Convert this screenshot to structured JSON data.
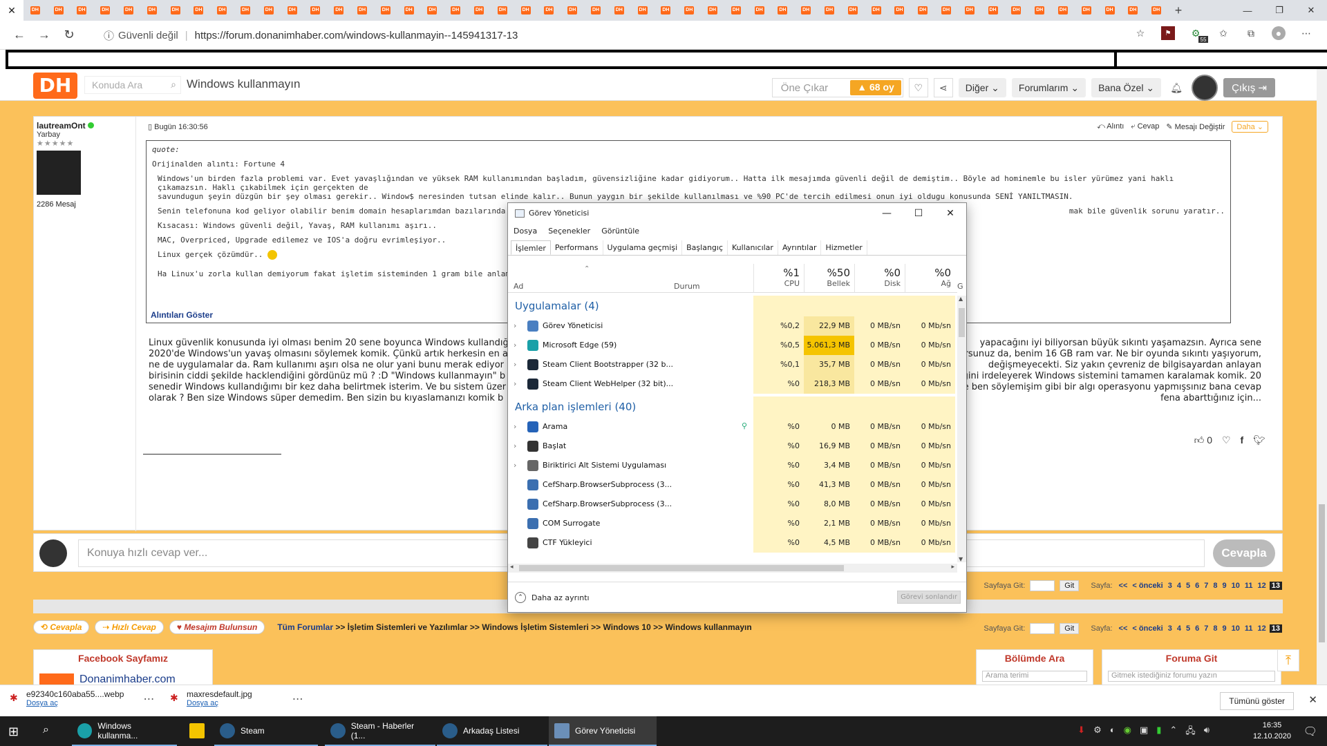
{
  "browser": {
    "tab_count": 49,
    "tab_favicon_label": "DH",
    "new_tab_icon": "+",
    "security_label": "Güvenli değil",
    "url": "https://forum.donanimhaber.com/windows-kullanmayin--145941317-13",
    "steam_ext_badge": "55"
  },
  "site": {
    "logo": "DH",
    "search_placeholder": "Konuda Ara",
    "topic_title": "Windows kullanmayın",
    "one_cikar": "Öne Çıkar",
    "vote_count": "68 oy",
    "menu_diger": "Diğer",
    "menu_forumlarim": "Forumlarım",
    "menu_bana_ozel": "Bana Özel",
    "cikis": "Çıkış"
  },
  "post": {
    "username": "lautreamOnt",
    "rank": "Yarbay",
    "stars": "★★★★★",
    "message_count": "2286 Mesaj",
    "time": "Bugün 16:30:56",
    "actions": [
      "Alıntı",
      "Cevap",
      "Mesajı Değiştir"
    ],
    "more": "Daha",
    "quote_label": "quote:",
    "quote_source": "Orijinalden alıntı: Fortune 4",
    "quote_p1a": "Windows'un birden fazla problemi var. Evet yavaşlığından ve yüksek RAM kullanımından başladım, güvensizliğine kadar gidiyorum.. Hatta ilk mesajımda güvenli değil de demiştim.. Böyle ad hominemle bu isler yürümez yani haklı çıkamazsın. Haklı çıkabilmek için gerçekten de",
    "quote_p1b": "savundugun şeyin düzgün bir şey olması gerekir.. Window$ neresinden tutsan elinde kalır.. Bunun yaygın bir şekilde kullanılması ve %90 PC'de tercih edilmesi onun iyi oldugu konusunda SENİ YANILTMASIN.",
    "quote_p2a": "Senin telefonuna kod geliyor olabilir benim domain hesaplarımdan bazılarında kod mod yok.",
    "quote_p2b": "mak bile güvenlik sorunu yaratır..",
    "quote_p3": "Kısacası: Windows güvenli değil, Yavaş, RAM kullanımı aşırı..",
    "quote_p4": "MAC, Overpriced, Upgrade edilemez ve IOS'a doğru evrimleşiyor..",
    "quote_p5": "Linux gerçek çözümdür..",
    "quote_p6": "Ha Linux'u zorla kullan demiyorum fakat işletim sisteminden 1 gram bile anlamadan, bidi bı",
    "show_quotes": "Alıntıları Göster",
    "body_left": [
      "Linux güvenlik konusunda iyi olması benim 20 sene boyunca Windows kullandığ",
      "2020'de Windows'un yavaş olmasını söylemek komik. Çünkü artık herkesin en a",
      "ne de uygulamalar da. Ram kullanımı aşırı olsa ne olur yani bunu merak ediyor",
      "birisinin ciddi şekilde hacklendiğini gördünüz mü ? :D \"Windows kullanmayın\" b",
      "senedir Windows kullandığımı bir kez daha belirtmek isterim. Ve bu sistem üzer",
      "olarak ? Ben size Windows süper demedim. Ben sizin bu kıyaslamanızı komik b"
    ],
    "body_right": [
      "yapacağını iyi biliyorsan büyük sıkıntı yaşamazsın. Ayrıca sene",
      "orsunuz da, benim 16 GB ram var. Ne bir oyunda sıkıntı yaşıyorum,",
      "değişmeyecekti. Siz yakın çevreniz de bilgisayardan anlayan",
      "ğini irdeleyerek Windows sistemini tamamen karalamak komik. 20",
      "ze ben söylemişim gibi bir algı operasyonu yapmışsınız bana cevap",
      " fena abarttığınız için..."
    ],
    "likes": "0",
    "reply_placeholder": "Konuya hızlı cevap ver...",
    "reply_button": "Cevapla"
  },
  "pagination": {
    "goto_label": "Sayfaya Git:",
    "go": "Git",
    "page_label": "Sayfa:",
    "first": "<<",
    "prev": "< önceki",
    "pages": [
      "3",
      "4",
      "5",
      "6",
      "7",
      "8",
      "9",
      "10",
      "11",
      "12"
    ],
    "current": "13"
  },
  "bottom": {
    "btn_cevapla": "Cevapla",
    "btn_hizli": "Hızlı Cevap",
    "btn_bulunsun": "Mesajım Bulunsun",
    "crumb_root": "Tüm Forumlar",
    "crumb_rest": " >> İşletim Sistemleri ve Yazılımlar >> Windows İşletim Sistemleri >> Windows 10 >> Windows kullanmayın",
    "facebook_title": "Facebook Sayfamız",
    "facebook_name": "Donanimhaber.com",
    "bolumde_ara": "Bölümde Ara",
    "bolumde_placeholder": "Arama terimi",
    "foruma_git": "Foruma Git",
    "foruma_placeholder": "Gitmek istediğiniz forumu yazın"
  },
  "taskmgr": {
    "title": "Görev Yöneticisi",
    "menu": [
      "Dosya",
      "Seçenekler",
      "Görüntüle"
    ],
    "tabs": [
      "İşlemler",
      "Performans",
      "Uygulama geçmişi",
      "Başlangıç",
      "Kullanıcılar",
      "Ayrıntılar",
      "Hizmetler"
    ],
    "col_name": "Ad",
    "col_status": "Durum",
    "cpu_pct": "%1",
    "cpu_label": "CPU",
    "mem_pct": "%50",
    "mem_label": "Bellek",
    "disk_pct": "%0",
    "disk_label": "Disk",
    "net_pct": "%0",
    "net_label": "Ağ",
    "extra_col": "G",
    "group_apps": "Uygulamalar (4)",
    "group_bg": "Arka plan işlemleri (40)",
    "apps": [
      {
        "name": "Görev Yöneticisi",
        "cpu": "%0,2",
        "mem": "22,9 MB",
        "disk": "0 MB/sn",
        "net": "0 Mb/sn",
        "icon": "#4a7fc1"
      },
      {
        "name": "Microsoft Edge (59)",
        "cpu": "%0,5",
        "mem": "5.061,3 MB",
        "disk": "0 MB/sn",
        "net": "0 Mb/sn",
        "icon": "#1aa0a8"
      },
      {
        "name": "Steam Client Bootstrapper (32 b...",
        "cpu": "%0,1",
        "mem": "35,7 MB",
        "disk": "0 MB/sn",
        "net": "0 Mb/sn",
        "icon": "#1b2838"
      },
      {
        "name": "Steam Client WebHelper (32 bit)...",
        "cpu": "%0",
        "mem": "218,3 MB",
        "disk": "0 MB/sn",
        "net": "0 Mb/sn",
        "icon": "#1b2838"
      }
    ],
    "background": [
      {
        "name": "Arama",
        "cpu": "%0",
        "mem": "0 MB",
        "disk": "0 MB/sn",
        "net": "0 Mb/sn",
        "icon": "#2563b8"
      },
      {
        "name": "Başlat",
        "cpu": "%0",
        "mem": "16,9 MB",
        "disk": "0 MB/sn",
        "net": "0 Mb/sn",
        "icon": "#333333"
      },
      {
        "name": "Biriktirici Alt Sistemi Uygulaması",
        "cpu": "%0",
        "mem": "3,4 MB",
        "disk": "0 MB/sn",
        "net": "0 Mb/sn",
        "icon": "#666666"
      },
      {
        "name": "CefSharp.BrowserSubprocess (3...",
        "cpu": "%0",
        "mem": "41,3 MB",
        "disk": "0 MB/sn",
        "net": "0 Mb/sn",
        "icon": "#3b6fb0"
      },
      {
        "name": "CefSharp.BrowserSubprocess (3...",
        "cpu": "%0",
        "mem": "8,0 MB",
        "disk": "0 MB/sn",
        "net": "0 Mb/sn",
        "icon": "#3b6fb0"
      },
      {
        "name": "COM Surrogate",
        "cpu": "%0",
        "mem": "2,1 MB",
        "disk": "0 MB/sn",
        "net": "0 Mb/sn",
        "icon": "#3b6fb0"
      },
      {
        "name": "CTF Yükleyici",
        "cpu": "%0",
        "mem": "4,5 MB",
        "disk": "0 MB/sn",
        "net": "0 Mb/sn",
        "icon": "#444444"
      }
    ],
    "fewer_details": "Daha az ayrıntı",
    "end_task": "Görevi sonlandır"
  },
  "downloads": {
    "file1": "e92340c160aba55....webp",
    "file2": "maxresdefault.jpg",
    "open": "Dosya aç",
    "show_all": "Tümünü göster"
  },
  "taskbar": {
    "apps": [
      "Windows kullanma...",
      "Steam",
      "Steam - Haberler (1...",
      "Arkadaş Listesi",
      "Görev Yöneticisi"
    ],
    "time": "16:35",
    "date": "12.10.2020"
  },
  "colors": {
    "page_bg": "#fbc15a",
    "brand": "#ff6a1a",
    "tm_highlight": "#fff4c4",
    "tm_mem_highlight": "#f9e79f",
    "tm_edge_mem": "#f5c400"
  }
}
